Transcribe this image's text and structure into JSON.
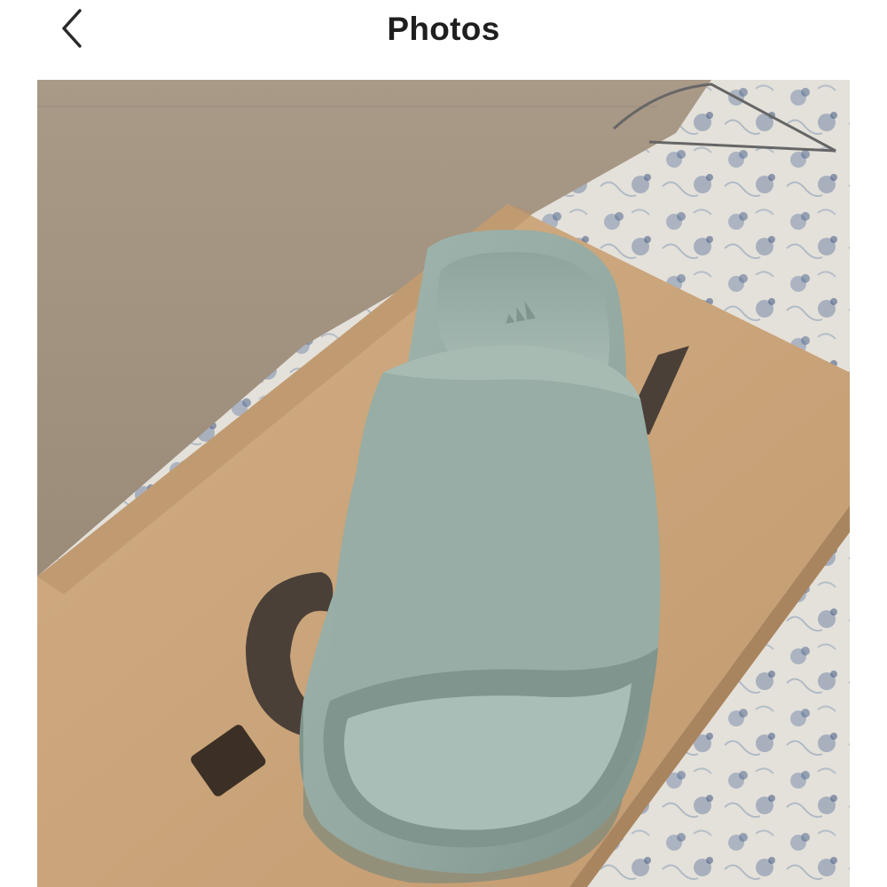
{
  "header": {
    "title": "Photos",
    "back_icon": "chevron-left-icon"
  },
  "photo": {
    "subject": "slide-sandal",
    "colors": {
      "sandal": "#94aaa2",
      "sandal_shadow": "#6f857d",
      "box": "#c9a37a",
      "wall": "#b09e8c",
      "quilt": "#e6e3dd",
      "quilt_pattern": "#5f7496"
    }
  }
}
